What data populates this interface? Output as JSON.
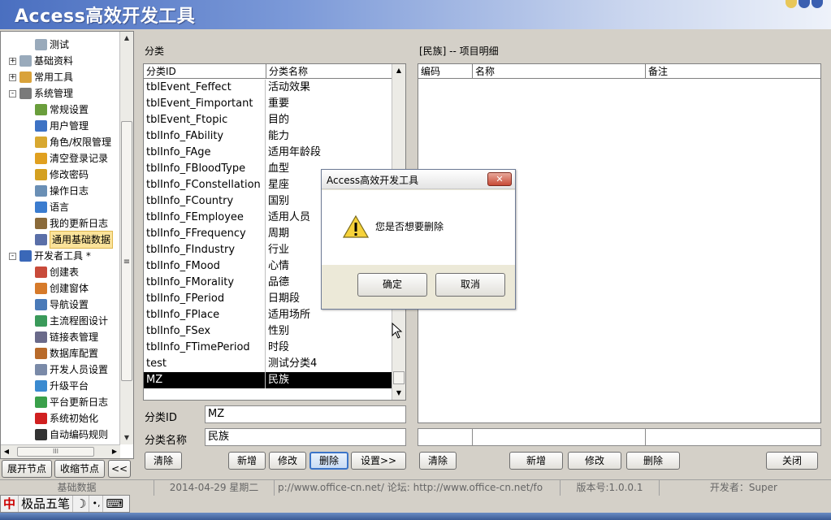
{
  "window": {
    "title": "Access高效开发工具"
  },
  "sidebar": {
    "items": [
      {
        "label": "测试",
        "icon": "page-icon",
        "level": 2
      },
      {
        "label": "基础资料",
        "icon": "page-icon",
        "level": 1,
        "expander": "+"
      },
      {
        "label": "常用工具",
        "icon": "person-icon",
        "level": 1,
        "expander": "+"
      },
      {
        "label": "系统管理",
        "icon": "tools-icon",
        "level": 1,
        "expander": "-"
      },
      {
        "label": "常规设置",
        "icon": "settings-icon",
        "level": 2
      },
      {
        "label": "用户管理",
        "icon": "user-icon",
        "level": 2
      },
      {
        "label": "角色/权限管理",
        "icon": "lock-icon",
        "level": 2
      },
      {
        "label": "清空登录记录",
        "icon": "clear-icon",
        "level": 2
      },
      {
        "label": "修改密码",
        "icon": "key-icon",
        "level": 2
      },
      {
        "label": "操作日志",
        "icon": "magnifier-icon",
        "level": 2
      },
      {
        "label": "语言",
        "icon": "book-icon",
        "level": 2
      },
      {
        "label": "我的更新日志",
        "icon": "log-icon",
        "level": 2
      },
      {
        "label": "通用基础数据",
        "icon": "data-icon",
        "level": 2,
        "selected": true
      },
      {
        "label": "开发者工具 *",
        "icon": "chart-icon",
        "level": 1,
        "expander": "-"
      },
      {
        "label": "创建表",
        "icon": "table-icon",
        "level": 2
      },
      {
        "label": "创建窗体",
        "icon": "form-icon",
        "level": 2
      },
      {
        "label": "导航设置",
        "icon": "nav-icon",
        "level": 2
      },
      {
        "label": "主流程图设计",
        "icon": "flow-icon",
        "level": 2
      },
      {
        "label": "链接表管理",
        "icon": "link-icon",
        "level": 2
      },
      {
        "label": "数据库配置",
        "icon": "database-icon",
        "level": 2
      },
      {
        "label": "开发人员设置",
        "icon": "developer-icon",
        "level": 2
      },
      {
        "label": "升级平台",
        "icon": "upgrade-icon",
        "level": 2
      },
      {
        "label": "平台更新日志",
        "icon": "update-log-icon",
        "level": 2
      },
      {
        "label": "系统初始化",
        "icon": "cross-icon",
        "level": 2
      },
      {
        "label": "自动编码规则",
        "icon": "list-icon",
        "level": 2
      }
    ],
    "hscroll_label": "III",
    "buttons": {
      "expand": "展开节点",
      "collapse": "收缩节点",
      "toggle": "<<"
    }
  },
  "category_panel": {
    "title": "分类",
    "columns": [
      "分类ID",
      "分类名称"
    ],
    "rows": [
      [
        "tblEvent_Feffect",
        "活动效果"
      ],
      [
        "tblEvent_Fimportant",
        "重要"
      ],
      [
        "tblEvent_Ftopic",
        "目的"
      ],
      [
        "tblInfo_FAbility",
        "能力"
      ],
      [
        "tblInfo_FAge",
        "适用年龄段"
      ],
      [
        "tblInfo_FBloodType",
        "血型"
      ],
      [
        "tblInfo_FConstellation",
        "星座"
      ],
      [
        "tblInfo_FCountry",
        "国别"
      ],
      [
        "tblInfo_FEmployee",
        "适用人员"
      ],
      [
        "tblInfo_FFrequency",
        "周期"
      ],
      [
        "tblInfo_FIndustry",
        "行业"
      ],
      [
        "tblInfo_FMood",
        "心情"
      ],
      [
        "tblInfo_FMorality",
        "品德"
      ],
      [
        "tblInfo_FPeriod",
        "日期段"
      ],
      [
        "tblInfo_FPlace",
        "适用场所"
      ],
      [
        "tblInfo_FSex",
        "性别"
      ],
      [
        "tblInfo_FTimePeriod",
        "时段"
      ],
      [
        "test",
        "测试分类4"
      ],
      [
        "MZ",
        "民族"
      ]
    ],
    "selected_index": 18,
    "id_label": "分类ID",
    "id_value": "MZ",
    "name_label": "分类名称",
    "name_value": "民族",
    "buttons": {
      "clear": "清除",
      "add": "新增",
      "edit": "修改",
      "delete": "删除",
      "settings": "设置>>"
    }
  },
  "detail_panel": {
    "title": "[民族] -- 项目明细",
    "columns": [
      "编码",
      "名称",
      "备注"
    ],
    "buttons": {
      "clear": "清除",
      "add": "新增",
      "edit": "修改",
      "delete": "删除",
      "close": "关闭"
    }
  },
  "statusbar": {
    "section": "基础数据",
    "date": "2014-04-29 星期二",
    "forum": "p://www.office-cn.net/   论坛: http://www.office-cn.net/fo",
    "version": "版本号:1.0.0.1",
    "developer": "开发者：Super"
  },
  "ime": {
    "logo": "中",
    "name": "极品五笔",
    "moon": "☽",
    "dots": "•,",
    "keyboard": "⌨"
  },
  "dialog": {
    "title": "Access高效开发工具",
    "close_label": "✕",
    "message": "您是否想要删除",
    "ok": "确定",
    "cancel": "取消"
  },
  "colors": {
    "title_gradient_start": "#4a6fc0",
    "selection": "#000000",
    "tree_selection": "#fbe39a",
    "dialog_bg": "#ece9d8"
  }
}
